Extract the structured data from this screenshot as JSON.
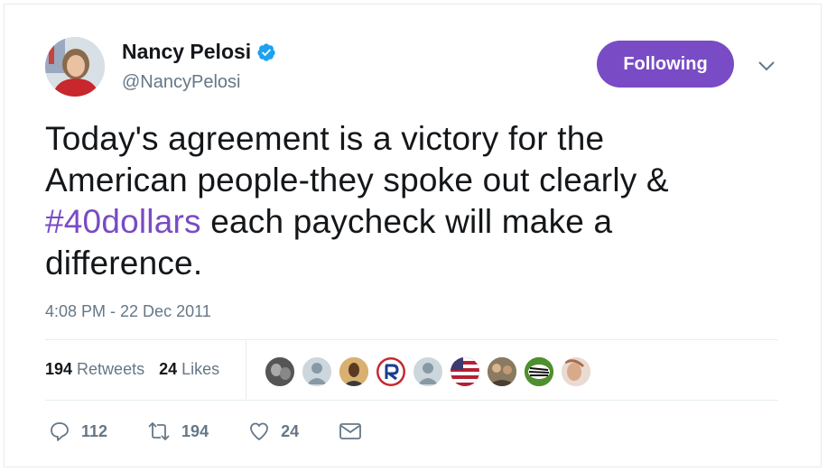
{
  "user": {
    "name": "Nancy Pelosi",
    "handle": "@NancyPelosi",
    "verified": true,
    "avatar_icon": "profile-photo"
  },
  "follow_button": {
    "label": "Following",
    "color": "#794bc4"
  },
  "tweet": {
    "text_line_1": "Today's agreement is a victory for the",
    "text_line_2": "American people-they spoke out clearly &",
    "hashtag": "#40dollars",
    "text_line_3_rest": " each paycheck will make a",
    "text_line_4": "difference.",
    "timestamp": "4:08 PM - 22 Dec 2011"
  },
  "stats": {
    "retweets_count": "194",
    "retweets_label": "Retweets",
    "likes_count": "24",
    "likes_label": "Likes"
  },
  "liker_avatars": [
    "avatar-1",
    "avatar-2",
    "avatar-3",
    "avatar-4",
    "avatar-5",
    "avatar-6",
    "avatar-7",
    "avatar-8",
    "avatar-9"
  ],
  "actions": {
    "reply_count": "112",
    "retweet_count": "194",
    "like_count": "24"
  },
  "colors": {
    "accent": "#794bc4",
    "secondary_text": "#657786",
    "verified": "#1da1f2"
  }
}
